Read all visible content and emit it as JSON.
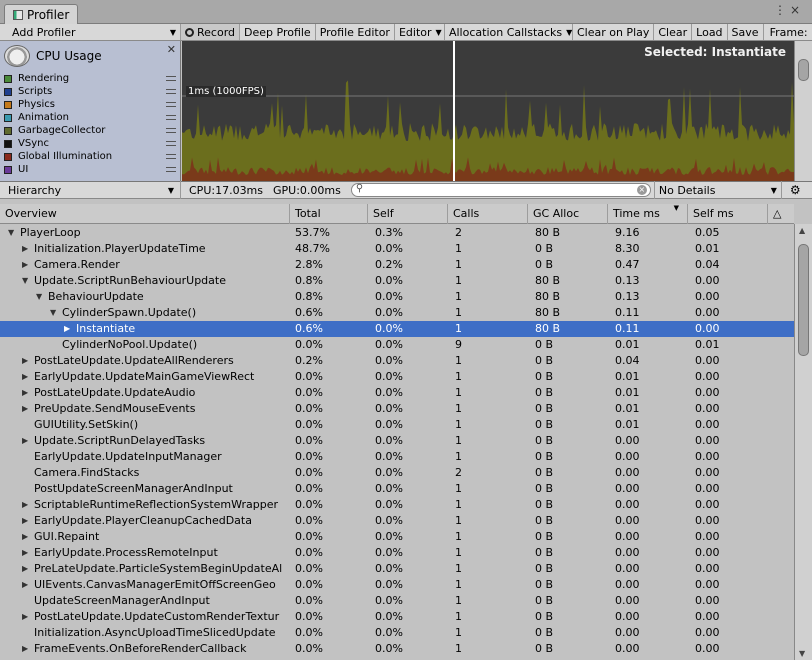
{
  "window": {
    "tab_title": "Profiler",
    "frame_label": "Frame:"
  },
  "toolbar": {
    "add_profiler": "Add Profiler",
    "record": "Record",
    "deep_profile": "Deep Profile",
    "profile_editor": "Profile Editor",
    "editor": "Editor",
    "allocation_callstacks": "Allocation Callstacks",
    "clear_on_play": "Clear on Play",
    "clear": "Clear",
    "load": "Load",
    "save": "Save"
  },
  "chart": {
    "title": "CPU Usage",
    "selected_label": "Selected: Instantiate",
    "fps_label": "1ms (1000FPS)",
    "legend": [
      {
        "label": "Rendering",
        "color": "#4a8a3a"
      },
      {
        "label": "Scripts",
        "color": "#1f3f8f"
      },
      {
        "label": "Physics",
        "color": "#c47a1c"
      },
      {
        "label": "Animation",
        "color": "#3a9ab0"
      },
      {
        "label": "GarbageCollector",
        "color": "#5f6a2e"
      },
      {
        "label": "VSync",
        "color": "#111111"
      },
      {
        "label": "Global Illumination",
        "color": "#8a2a1e"
      },
      {
        "label": "UI",
        "color": "#6a3a9a"
      }
    ]
  },
  "lower_toolbar": {
    "view_mode": "Hierarchy",
    "cpu": "CPU:17.03ms",
    "gpu": "GPU:0.00ms",
    "search_placeholder": "",
    "details": "No Details"
  },
  "table": {
    "columns": [
      "Overview",
      "Total",
      "Self",
      "Calls",
      "GC Alloc",
      "Time ms",
      "Self ms"
    ],
    "rows": [
      {
        "name": "PlayerLoop",
        "total": "53.7%",
        "self": "0.3%",
        "calls": "2",
        "gc": "80 B",
        "time": "9.16",
        "selfms": "0.05",
        "depth": 0,
        "exp": "open"
      },
      {
        "name": "Initialization.PlayerUpdateTime",
        "total": "48.7%",
        "self": "0.0%",
        "calls": "1",
        "gc": "0 B",
        "time": "8.30",
        "selfms": "0.01",
        "depth": 1,
        "exp": "closed"
      },
      {
        "name": "Camera.Render",
        "total": "2.8%",
        "self": "0.2%",
        "calls": "1",
        "gc": "0 B",
        "time": "0.47",
        "selfms": "0.04",
        "depth": 1,
        "exp": "closed"
      },
      {
        "name": "Update.ScriptRunBehaviourUpdate",
        "total": "0.8%",
        "self": "0.0%",
        "calls": "1",
        "gc": "80 B",
        "time": "0.13",
        "selfms": "0.00",
        "depth": 1,
        "exp": "open"
      },
      {
        "name": "BehaviourUpdate",
        "total": "0.8%",
        "self": "0.0%",
        "calls": "1",
        "gc": "80 B",
        "time": "0.13",
        "selfms": "0.00",
        "depth": 2,
        "exp": "open"
      },
      {
        "name": "CylinderSpawn.Update()",
        "total": "0.6%",
        "self": "0.0%",
        "calls": "1",
        "gc": "80 B",
        "time": "0.11",
        "selfms": "0.00",
        "depth": 3,
        "exp": "open"
      },
      {
        "name": "Instantiate",
        "total": "0.6%",
        "self": "0.0%",
        "calls": "1",
        "gc": "80 B",
        "time": "0.11",
        "selfms": "0.00",
        "depth": 4,
        "exp": "closed",
        "selected": true
      },
      {
        "name": "CylinderNoPool.Update()",
        "total": "0.0%",
        "self": "0.0%",
        "calls": "9",
        "gc": "0 B",
        "time": "0.01",
        "selfms": "0.01",
        "depth": 3,
        "exp": "none"
      },
      {
        "name": "PostLateUpdate.UpdateAllRenderers",
        "total": "0.2%",
        "self": "0.0%",
        "calls": "1",
        "gc": "0 B",
        "time": "0.04",
        "selfms": "0.00",
        "depth": 1,
        "exp": "closed"
      },
      {
        "name": "EarlyUpdate.UpdateMainGameViewRect",
        "total": "0.0%",
        "self": "0.0%",
        "calls": "1",
        "gc": "0 B",
        "time": "0.01",
        "selfms": "0.00",
        "depth": 1,
        "exp": "closed"
      },
      {
        "name": "PostLateUpdate.UpdateAudio",
        "total": "0.0%",
        "self": "0.0%",
        "calls": "1",
        "gc": "0 B",
        "time": "0.01",
        "selfms": "0.00",
        "depth": 1,
        "exp": "closed"
      },
      {
        "name": "PreUpdate.SendMouseEvents",
        "total": "0.0%",
        "self": "0.0%",
        "calls": "1",
        "gc": "0 B",
        "time": "0.01",
        "selfms": "0.00",
        "depth": 1,
        "exp": "closed"
      },
      {
        "name": "GUIUtility.SetSkin()",
        "total": "0.0%",
        "self": "0.0%",
        "calls": "1",
        "gc": "0 B",
        "time": "0.01",
        "selfms": "0.00",
        "depth": 1,
        "exp": "none"
      },
      {
        "name": "Update.ScriptRunDelayedTasks",
        "total": "0.0%",
        "self": "0.0%",
        "calls": "1",
        "gc": "0 B",
        "time": "0.00",
        "selfms": "0.00",
        "depth": 1,
        "exp": "closed"
      },
      {
        "name": "EarlyUpdate.UpdateInputManager",
        "total": "0.0%",
        "self": "0.0%",
        "calls": "1",
        "gc": "0 B",
        "time": "0.00",
        "selfms": "0.00",
        "depth": 1,
        "exp": "none"
      },
      {
        "name": "Camera.FindStacks",
        "total": "0.0%",
        "self": "0.0%",
        "calls": "2",
        "gc": "0 B",
        "time": "0.00",
        "selfms": "0.00",
        "depth": 1,
        "exp": "none"
      },
      {
        "name": "PostUpdateScreenManagerAndInput",
        "total": "0.0%",
        "self": "0.0%",
        "calls": "1",
        "gc": "0 B",
        "time": "0.00",
        "selfms": "0.00",
        "depth": 1,
        "exp": "none"
      },
      {
        "name": "ScriptableRuntimeReflectionSystemWrapper",
        "total": "0.0%",
        "self": "0.0%",
        "calls": "1",
        "gc": "0 B",
        "time": "0.00",
        "selfms": "0.00",
        "depth": 1,
        "exp": "closed"
      },
      {
        "name": "EarlyUpdate.PlayerCleanupCachedData",
        "total": "0.0%",
        "self": "0.0%",
        "calls": "1",
        "gc": "0 B",
        "time": "0.00",
        "selfms": "0.00",
        "depth": 1,
        "exp": "closed"
      },
      {
        "name": "GUI.Repaint",
        "total": "0.0%",
        "self": "0.0%",
        "calls": "1",
        "gc": "0 B",
        "time": "0.00",
        "selfms": "0.00",
        "depth": 1,
        "exp": "closed"
      },
      {
        "name": "EarlyUpdate.ProcessRemoteInput",
        "total": "0.0%",
        "self": "0.0%",
        "calls": "1",
        "gc": "0 B",
        "time": "0.00",
        "selfms": "0.00",
        "depth": 1,
        "exp": "closed"
      },
      {
        "name": "PreLateUpdate.ParticleSystemBeginUpdateAl",
        "total": "0.0%",
        "self": "0.0%",
        "calls": "1",
        "gc": "0 B",
        "time": "0.00",
        "selfms": "0.00",
        "depth": 1,
        "exp": "closed"
      },
      {
        "name": "UIEvents.CanvasManagerEmitOffScreenGeo",
        "total": "0.0%",
        "self": "0.0%",
        "calls": "1",
        "gc": "0 B",
        "time": "0.00",
        "selfms": "0.00",
        "depth": 1,
        "exp": "closed"
      },
      {
        "name": "UpdateScreenManagerAndInput",
        "total": "0.0%",
        "self": "0.0%",
        "calls": "1",
        "gc": "0 B",
        "time": "0.00",
        "selfms": "0.00",
        "depth": 1,
        "exp": "none"
      },
      {
        "name": "PostLateUpdate.UpdateCustomRenderTextur",
        "total": "0.0%",
        "self": "0.0%",
        "calls": "1",
        "gc": "0 B",
        "time": "0.00",
        "selfms": "0.00",
        "depth": 1,
        "exp": "closed"
      },
      {
        "name": "Initialization.AsyncUploadTimeSlicedUpdate",
        "total": "0.0%",
        "self": "0.0%",
        "calls": "1",
        "gc": "0 B",
        "time": "0.00",
        "selfms": "0.00",
        "depth": 1,
        "exp": "none"
      },
      {
        "name": "FrameEvents.OnBeforeRenderCallback",
        "total": "0.0%",
        "self": "0.0%",
        "calls": "1",
        "gc": "0 B",
        "time": "0.00",
        "selfms": "0.00",
        "depth": 1,
        "exp": "closed"
      }
    ]
  }
}
